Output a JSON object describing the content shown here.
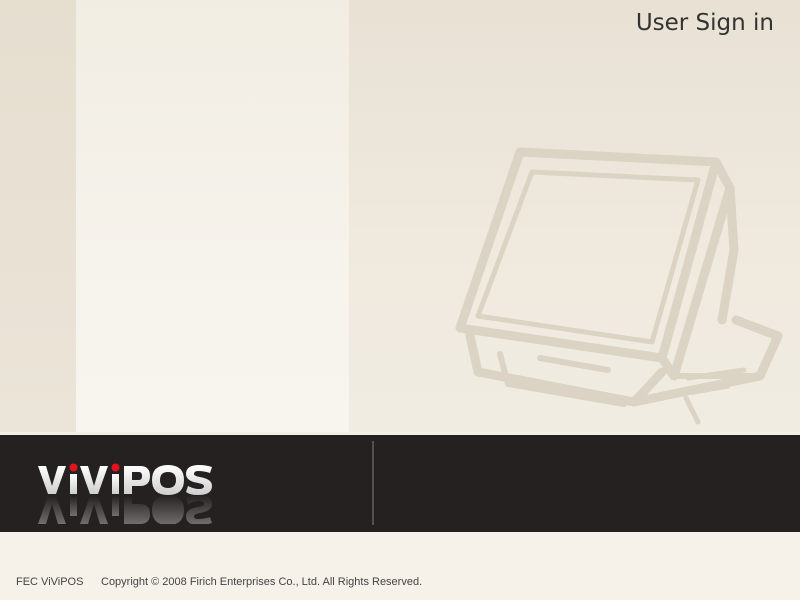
{
  "header": {
    "title": "User Sign in"
  },
  "brand": {
    "logo_text": "ViViPOS",
    "accent_color": "#e0141e"
  },
  "footer": {
    "product": "FEC ViViPOS",
    "copyright": "Copyright © 2008 Firich Enterprises Co., Ltd. All Rights Reserved."
  },
  "illustration": {
    "icon": "pos-terminal-icon"
  }
}
